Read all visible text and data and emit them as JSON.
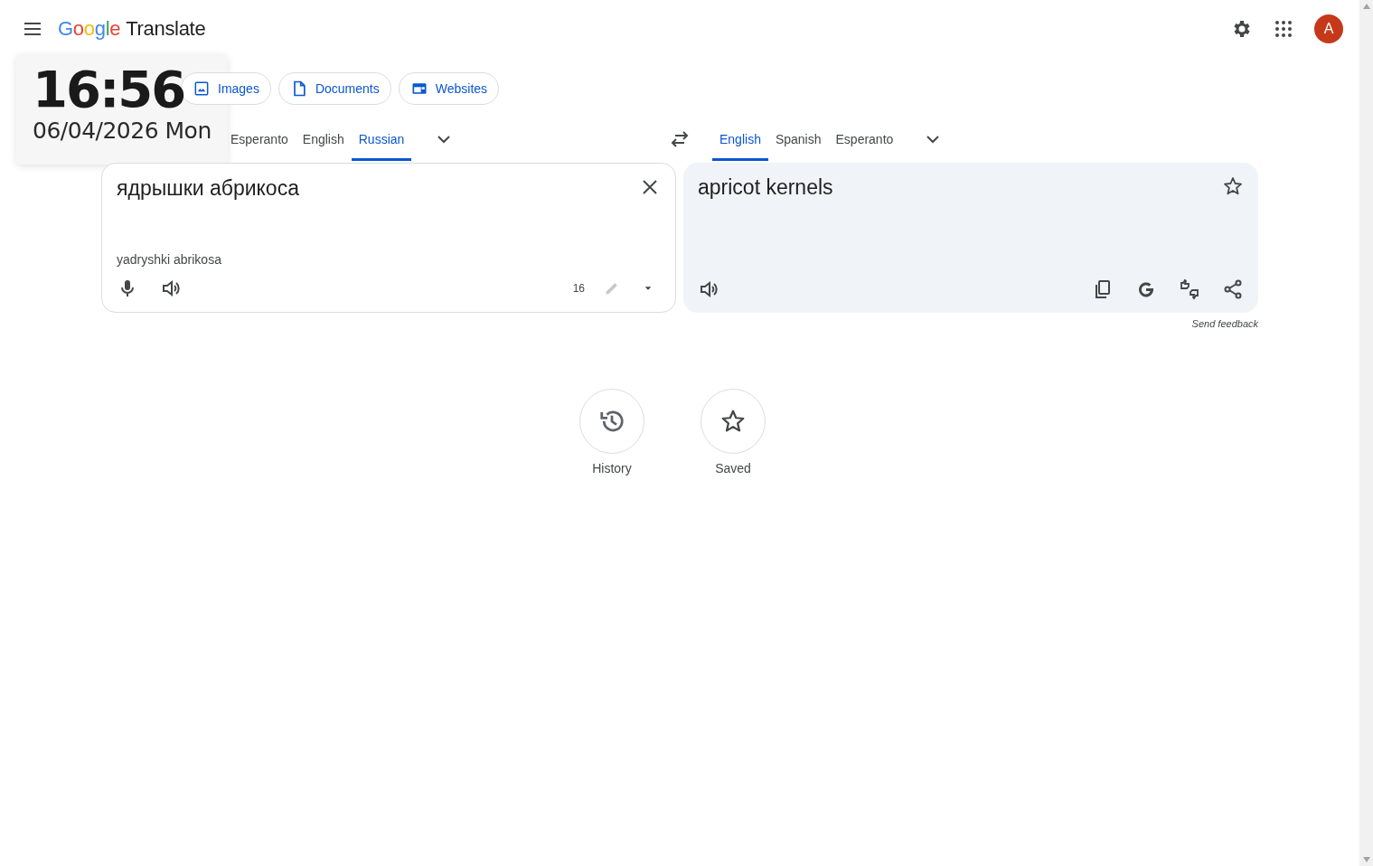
{
  "header": {
    "logo_word": "Google",
    "product": "Translate",
    "avatar_letter": "A"
  },
  "modes": [
    {
      "kind": "images",
      "label": "Images",
      "selected": false
    },
    {
      "kind": "documents",
      "label": "Documents",
      "selected": false
    },
    {
      "kind": "websites",
      "label": "Websites",
      "selected": false
    }
  ],
  "source_languages": [
    {
      "label": "Esperanto",
      "selected": false
    },
    {
      "label": "English",
      "selected": false
    },
    {
      "label": "Russian",
      "selected": true
    }
  ],
  "target_languages": [
    {
      "label": "English",
      "selected": true
    },
    {
      "label": "Spanish",
      "selected": false
    },
    {
      "label": "Esperanto",
      "selected": false
    }
  ],
  "source": {
    "text": "ядрышки абрикоса",
    "transliteration": "yadryshki abrikosa",
    "char_count": "16"
  },
  "target": {
    "text": "apricot kernels",
    "saved": false
  },
  "feedback_link": "Send feedback",
  "shortcuts": [
    {
      "kind": "history",
      "label": "History"
    },
    {
      "kind": "saved",
      "label": "Saved"
    }
  ],
  "clock_widget": {
    "time": "16:56",
    "date": "06/04/2026 Mon"
  }
}
